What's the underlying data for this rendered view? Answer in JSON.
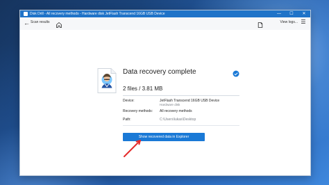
{
  "window": {
    "title": "Disk Drill - All recovery methods - Hardware disk JetFlash Transcend 16GB USB Device",
    "minimize_glyph": "—",
    "maximize_glyph": "☐",
    "close_glyph": "✕"
  },
  "toolbar": {
    "back_label": "Scan results",
    "view_logs_label": "View logs..."
  },
  "result": {
    "heading": "Data recovery complete",
    "summary": "2 files / 3.81 MB",
    "device_label": "Device:",
    "device_name": "JetFlash Transcend 16GB USB Device",
    "device_type": "Hardware disk",
    "methods_label": "Recovery methods:",
    "methods_value": "All recovery methods",
    "path_label": "Path:",
    "path_value": "C:\\Users\\lukas\\Desktop",
    "button_label": "Show recovered data in Explorer"
  },
  "colors": {
    "titlebar": "#1f73c8",
    "accent": "#1a79d6",
    "annotation": "#e52b2b",
    "status": "#1a79d6"
  },
  "icons": {
    "app": "disk-drill-icon",
    "back": "arrow-left-icon",
    "home": "home-icon",
    "view_logs": "document-icon",
    "menu": "hamburger-menu-icon",
    "status": "checkmark-badge-icon",
    "file": "document-preview-icon",
    "annotation": "red-arrow-icon"
  }
}
